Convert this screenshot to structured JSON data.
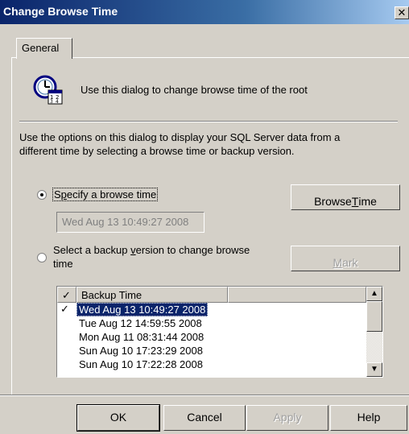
{
  "window": {
    "title": "Change Browse Time",
    "close_glyph": "✕"
  },
  "tabs": [
    {
      "label": "General",
      "active": true
    }
  ],
  "header": {
    "icon": "clock-calendar-icon",
    "description": "Use this dialog to change browse time of the root"
  },
  "info_text": {
    "line1": "Use the options on this dialog to display your SQL Server data from a",
    "line2": "different time by selecting a browse time or backup version."
  },
  "option_browse": {
    "label_prefix": "S",
    "label_mnemonic": "p",
    "label_rest": "ecify a browse time",
    "selected": true,
    "current_value": "Wed Aug 13 10:49:27 2008",
    "button_prefix": "Browse ",
    "button_mnemonic": "T",
    "button_rest": "ime"
  },
  "option_backup": {
    "label_line1_prefix": "Select a backup ",
    "label_line1_mnemonic": "v",
    "label_line1_rest": "ersion to change browse",
    "label_line2": "time",
    "selected": false,
    "mark_button_mnemonic": "M",
    "mark_button_rest": "ark",
    "mark_enabled": false
  },
  "backup_list": {
    "check_header": "✓",
    "column_header": "Backup Time",
    "rows": [
      {
        "checked": "✓",
        "value": "Wed Aug 13 10:49:27 2008",
        "selected": true
      },
      {
        "checked": "",
        "value": "Tue Aug 12 14:59:55 2008",
        "selected": false
      },
      {
        "checked": "",
        "value": "Mon Aug 11 08:31:44 2008",
        "selected": false
      },
      {
        "checked": "",
        "value": "Sun Aug 10 17:23:29 2008",
        "selected": false
      },
      {
        "checked": "",
        "value": "Sun Aug 10 17:22:28 2008",
        "selected": false
      }
    ],
    "scroll_up_glyph": "▲",
    "scroll_down_glyph": "▼"
  },
  "footer": {
    "ok": "OK",
    "cancel": "Cancel",
    "apply": "Apply",
    "help": "Help",
    "apply_enabled": false
  },
  "colors": {
    "title_bar": "#0a246a",
    "face": "#d4d0c8",
    "selection": "#0a246a"
  }
}
